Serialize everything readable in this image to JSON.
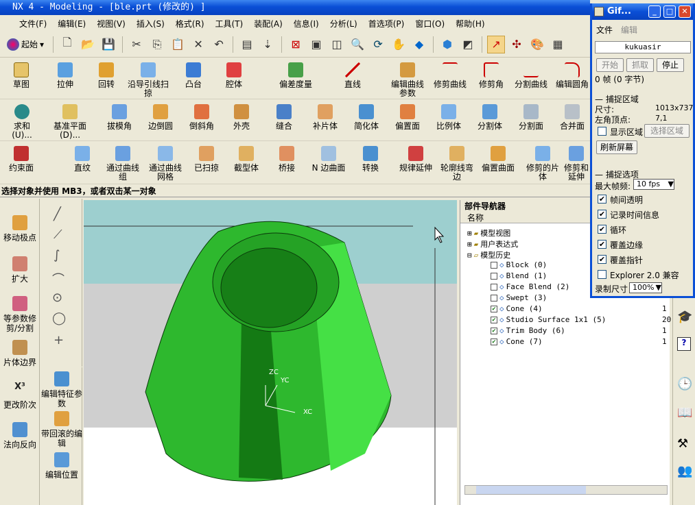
{
  "window": {
    "title": "NX 4 - Modeling - [ble.prt  (修改的) ]"
  },
  "menubar": [
    "文件(F)",
    "编辑(E)",
    "视图(V)",
    "插入(S)",
    "格式(R)",
    "工具(T)",
    "装配(A)",
    "信息(I)",
    "分析(L)",
    "首选项(P)",
    "窗口(O)",
    "帮助(H)"
  ],
  "toolbar": {
    "start_label": "起始"
  },
  "ribbon1": [
    "草图",
    "拉伸",
    "回转",
    "沿导引线扫掠",
    "凸台",
    "腔体",
    "偏差度量",
    "直线",
    "编辑曲线参数",
    "修剪曲线",
    "修剪角",
    "分割曲线",
    "编辑圆角"
  ],
  "ribbon2": [
    "求和(U)...",
    "基准平面(D)...",
    "拔模角",
    "边倒圆",
    "倒斜角",
    "外壳",
    "缝合",
    "补片体",
    "简化体",
    "偏置面",
    "比例体",
    "分割体",
    "分割面",
    "合并面"
  ],
  "ribbon3": [
    "约束面",
    "直纹",
    "通过曲线组",
    "通过曲线网格",
    "已扫掠",
    "截型体",
    "桥接",
    "N 边曲面",
    "转换",
    "规律延伸",
    "轮廓线弯边",
    "偏置曲面",
    "修剪的片体",
    "修剪和延伸"
  ],
  "status": {
    "prompt": "选择对象并使用 MB3，或者双击某一对象"
  },
  "leftbar": [
    "移动极点",
    "扩大",
    "等参数修剪/分割",
    "片体边界",
    "更改阶次",
    "法向反向"
  ],
  "editbar": [
    "编辑特征参数",
    "带回滚的编辑",
    "编辑位置"
  ],
  "viewport": {
    "axes": {
      "zc": "ZC",
      "yc": "YC",
      "xc": "XC"
    }
  },
  "navigator": {
    "title": "部件导航器",
    "col_name": "名称",
    "groups": [
      "模型视图",
      "用户表达式",
      "模型历史"
    ],
    "features": [
      {
        "name": "Block (0)",
        "checked": false,
        "extra": ""
      },
      {
        "name": "Blend (1)",
        "checked": false,
        "extra": ""
      },
      {
        "name": "Face Blend (2)",
        "checked": false,
        "extra": ""
      },
      {
        "name": "Swept (3)",
        "checked": false,
        "extra": ""
      },
      {
        "name": "Cone (4)",
        "checked": true,
        "extra": "1"
      },
      {
        "name": "Studio Surface 1x1 (5)",
        "checked": true,
        "extra": "20"
      },
      {
        "name": "Trim Body (6)",
        "checked": true,
        "extra": "1"
      },
      {
        "name": "Cone (7)",
        "checked": true,
        "extra": "1"
      }
    ]
  },
  "gif": {
    "title": "Gif...",
    "menu": [
      "文件",
      "编辑"
    ],
    "username": "kukuasir",
    "btn_start": "开始",
    "btn_capture": "抓取",
    "btn_stop": "停止",
    "frames": "0 帧 (0 字节)",
    "section_area": "捕捉区域",
    "size_label": "尺寸:",
    "size_value": "1013x737",
    "corner_label": "左角顶点:",
    "corner_value": "7,1",
    "show_area": "显示区域",
    "select_area": "选择区域",
    "refresh": "刷新屏幕",
    "section_options": "捕捉选项",
    "max_fps_label": "最大帧频:",
    "max_fps_value": "10 fps",
    "opts": [
      {
        "label": "帧间透明",
        "checked": true
      },
      {
        "label": "记录时间信息",
        "checked": true
      },
      {
        "label": "循环",
        "checked": true
      },
      {
        "label": "覆盖边缘",
        "checked": true
      },
      {
        "label": "覆盖指针",
        "checked": true
      },
      {
        "label": "Explorer 2.0 兼容",
        "checked": false
      }
    ],
    "rec_size_label": "录制尺寸",
    "rec_size_value": "100%"
  },
  "colors": {
    "cone_dark": "#1a8a1a",
    "cone_light": "#3dcc3d",
    "viewport_top": "#9dcfcf",
    "viewport_mid": "#cfcfcf"
  }
}
